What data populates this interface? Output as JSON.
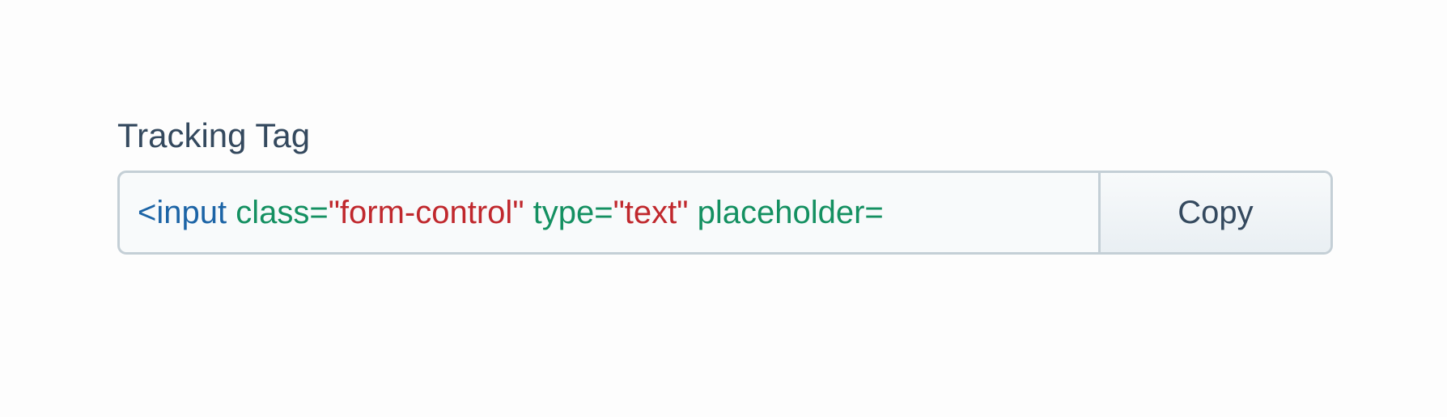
{
  "form": {
    "label": "Tracking Tag",
    "code_tokens": [
      {
        "kind": "tag",
        "text": "<input"
      },
      {
        "kind": "plain",
        "text": " "
      },
      {
        "kind": "attr",
        "text": "class="
      },
      {
        "kind": "str",
        "text": "\"form-control\""
      },
      {
        "kind": "plain",
        "text": " "
      },
      {
        "kind": "attr",
        "text": "type="
      },
      {
        "kind": "str",
        "text": "\"text\""
      },
      {
        "kind": "plain",
        "text": " "
      },
      {
        "kind": "attr",
        "text": "placeholder="
      }
    ],
    "copy_label": "Copy"
  },
  "colors": {
    "label_text": "#34495e",
    "border": "#c4cfd6",
    "field_background": "#f8fafb",
    "syntax_tag": "#1c64a6",
    "syntax_attribute": "#149061",
    "syntax_string": "#c0282d"
  }
}
